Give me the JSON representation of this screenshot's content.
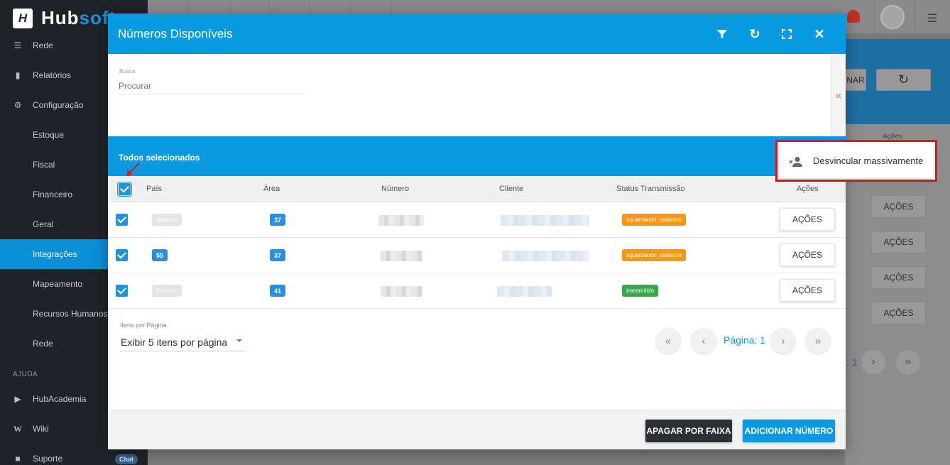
{
  "app": {
    "logo_text_a": "Hub",
    "logo_text_b": "soft"
  },
  "sidebar": {
    "items": [
      {
        "label": "Rede",
        "icon": "server-icon"
      },
      {
        "label": "Relatórios",
        "icon": "document-icon"
      },
      {
        "label": "Configuração",
        "icon": "gear-icon"
      },
      {
        "label": "Estoque"
      },
      {
        "label": "Fiscal"
      },
      {
        "label": "Financeiro"
      },
      {
        "label": "Geral"
      },
      {
        "label": "Integrações"
      },
      {
        "label": "Mapeamento"
      },
      {
        "label": "Recursos Humanos"
      },
      {
        "label": "Rede"
      },
      {
        "label": "HubAcademia",
        "icon": "youtube-icon"
      },
      {
        "label": "Wiki",
        "icon": "wikipedia-icon"
      },
      {
        "label": "Suporte",
        "icon": "chat-icon"
      }
    ],
    "section_ajuda": "AJUDA",
    "chat_badge": "Chat",
    "active_item": "Integrações"
  },
  "background": {
    "btn_partial": "NAR",
    "acoes_header": "Ações",
    "acoes_buttons": [
      "AÇÕES",
      "AÇÕES",
      "AÇÕES",
      "AÇÕES"
    ],
    "page_partial": ": 1"
  },
  "modal": {
    "title": "Números Disponíveis",
    "search": {
      "label": "Busca",
      "placeholder": "Procurar"
    },
    "selection_text": "Todos selecionados",
    "columns": [
      "País",
      "Área",
      "Número",
      "Cliente",
      "Status Transmissão",
      "Ações"
    ],
    "rows": [
      {
        "pais": "Nenhum",
        "area": "37",
        "status": "aguardando_cadastro",
        "status_color": "#f39a12",
        "action": "AÇÕES",
        "checked": true
      },
      {
        "pais": "55",
        "area": "37",
        "status": "aguardando_cadastro",
        "status_color": "#f39a12",
        "action": "AÇÕES",
        "checked": true
      },
      {
        "pais": "Nenhum",
        "area": "41",
        "status": "transmitido",
        "status_color": "#3aa84a",
        "action": "AÇÕES",
        "checked": true
      }
    ],
    "pagination": {
      "items_label": "Itens por Página",
      "items_value": "Exibir 5 itens por página",
      "page_label": "Página: 1"
    },
    "footer": {
      "delete_range": "APAGAR POR FAIXA",
      "add_number": "ADICIONAR NÚMERO"
    }
  },
  "popup_menu": {
    "item_label": "Desvincular massivamente",
    "item_icon": "remove-user-icon"
  },
  "colors": {
    "accent": "#0a9ae2",
    "highlight": "#e0161b",
    "dark_button": "#2b3038"
  }
}
